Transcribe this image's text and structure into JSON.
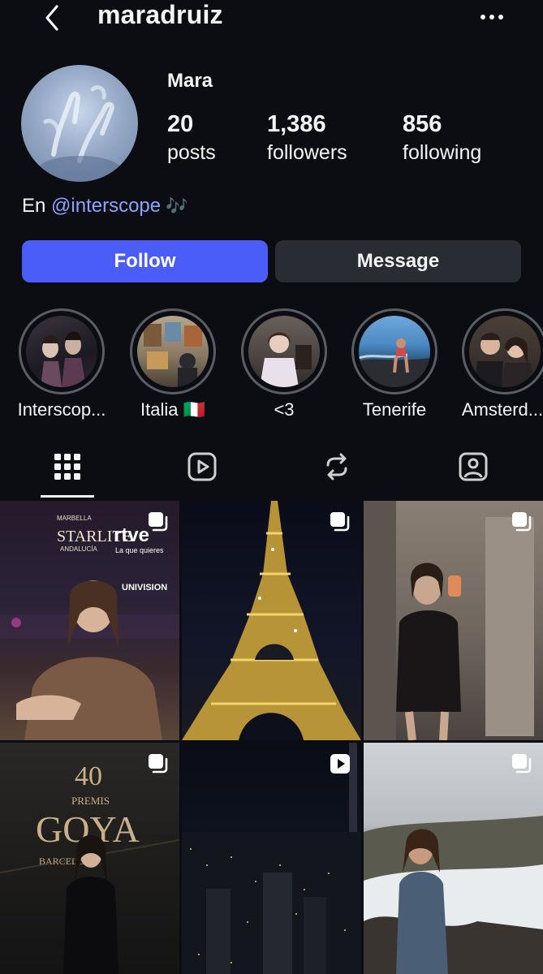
{
  "header": {
    "username": "maradruiz"
  },
  "profile": {
    "display_name": "Mara",
    "stats": {
      "posts": {
        "value": "20",
        "label": "posts"
      },
      "followers": {
        "value": "1,386",
        "label": "followers"
      },
      "following": {
        "value": "856",
        "label": "following"
      }
    },
    "bio": {
      "prefix": "En ",
      "mention": "@interscope",
      "suffix": " 🎶"
    }
  },
  "actions": {
    "follow_label": "Follow",
    "message_label": "Message"
  },
  "highlights": [
    {
      "label": "Interscop..."
    },
    {
      "label": "Italia 🇮🇹"
    },
    {
      "label": "<3"
    },
    {
      "label": "Tenerife"
    },
    {
      "label": "Amsterd..."
    }
  ],
  "tabs": [
    "grid-icon",
    "reels-icon",
    "reposts-icon",
    "tagged-icon"
  ],
  "colors": {
    "accent": "#4a5df9",
    "mention": "#8ea3ff",
    "background": "#0b0d12"
  },
  "posts": [
    {
      "badge": "carousel-icon",
      "overlay_texts": [
        "MARBELLA",
        "STARLITE",
        "ANDALUCÍA",
        "rtve",
        "La que quieres",
        "UNIVISION"
      ]
    },
    {
      "badge": "carousel-icon",
      "overlay_texts": []
    },
    {
      "badge": "carousel-icon",
      "overlay_texts": []
    },
    {
      "badge": "carousel-icon",
      "overlay_texts": [
        "40",
        "PREMIS",
        "GOYA",
        "BARCELONA"
      ]
    },
    {
      "badge": "reel-icon",
      "overlay_texts": []
    },
    {
      "badge": "carousel-icon",
      "overlay_texts": []
    }
  ]
}
